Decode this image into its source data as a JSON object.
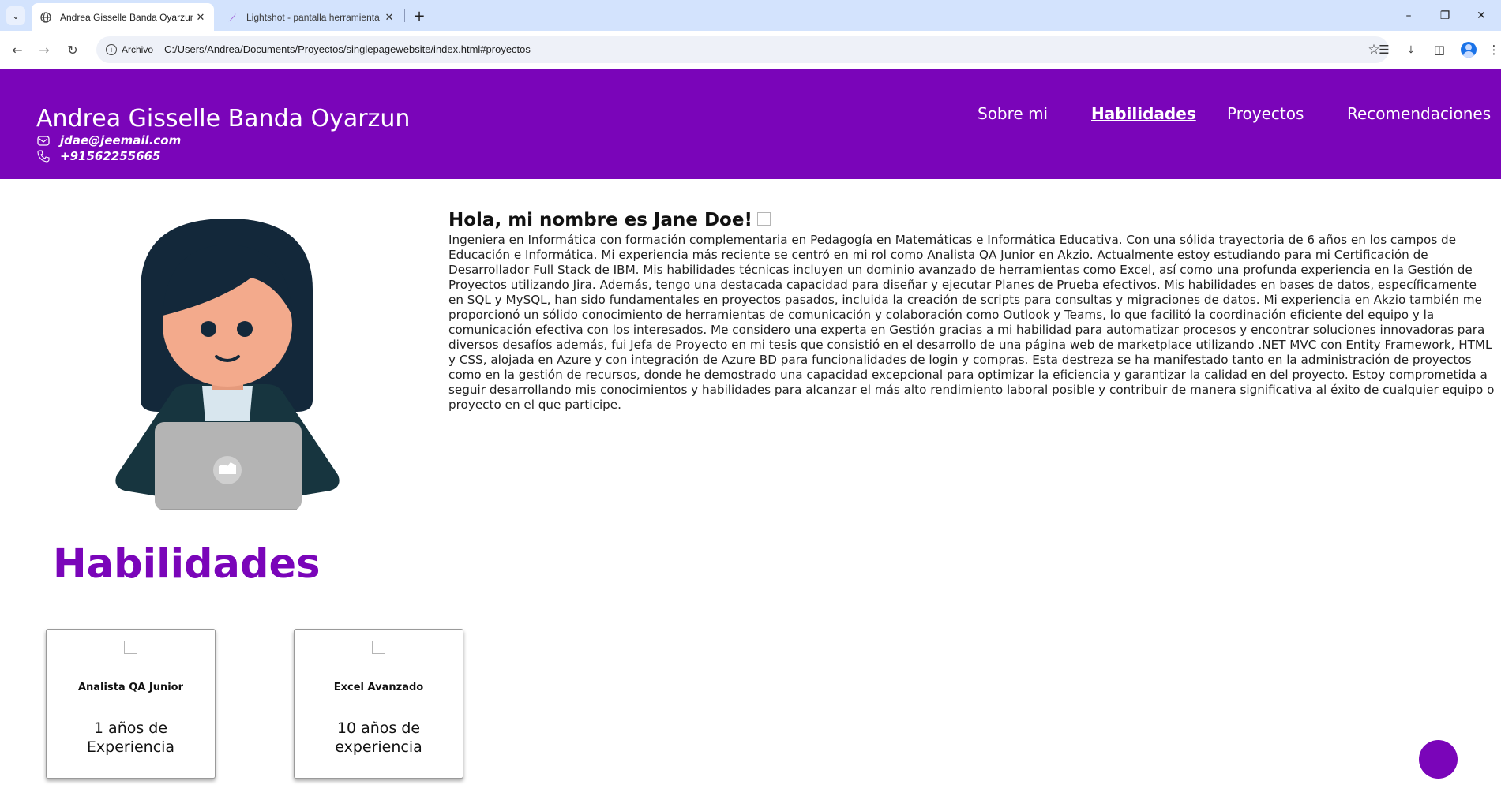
{
  "browser": {
    "tabs": [
      {
        "title": "Andrea Gisselle Banda Oyarzun",
        "favicon": "globe-icon",
        "active": true
      },
      {
        "title": "Lightshot - pantalla herramienta",
        "favicon": "feather-icon",
        "active": false
      }
    ],
    "chip_label": "Archivo",
    "url": "C:/Users/Andrea/Documents/Proyectos/singlepagewebsite/index.html#proyectos"
  },
  "header": {
    "name": "Andrea Gisselle Banda Oyarzun",
    "email": "jdae@jeemail.com",
    "phone": "+91562255665",
    "nav": [
      {
        "label": "Sobre mi",
        "active": false
      },
      {
        "label": "Habilidades",
        "active": true
      },
      {
        "label": "Proyectos",
        "active": false
      },
      {
        "label": "Recomendaciones",
        "active": false
      }
    ]
  },
  "intro": {
    "title": "Hola, mi nombre es Jane Doe!",
    "text": "Ingeniera en Informática con formación complementaria en Pedagogía en Matemáticas e Informática Educativa. Con una sólida trayectoria de 6 años en los campos de Educación e Informática. Mi experiencia más reciente se centró en mi rol como Analista QA Junior en Akzio. Actualmente estoy estudiando para mi Certificación de Desarrollador Full Stack de IBM. Mis habilidades técnicas incluyen un dominio avanzado de herramientas como Excel, así como una profunda experiencia en la Gestión de Proyectos utilizando Jira. Además, tengo una destacada capacidad para diseñar y ejecutar Planes de Prueba efectivos. Mis habilidades en bases de datos, específicamente en SQL y MySQL, han sido fundamentales en proyectos pasados, incluida la creación de scripts para consultas y migraciones de datos. Mi experiencia en Akzio también me proporcionó un sólido conocimiento de herramientas de comunicación y colaboración como Outlook y Teams, lo que facilitó la coordinación eficiente del equipo y la comunicación efectiva con los interesados. Me considero una experta en Gestión gracias a mi habilidad para automatizar procesos y encontrar soluciones innovadoras para diversos desafíos además, fui Jefa de Proyecto en mi tesis que consistió en el desarrollo de una página web de marketplace utilizando .NET MVC con Entity Framework, HTML y CSS, alojada en Azure y con integración de Azure BD para funcionalidades de login y compras. Esta destreza se ha manifestado tanto en la administración de proyectos como en la gestión de recursos, donde he demostrado una capacidad excepcional para optimizar la eficiencia y garantizar la calidad en del proyecto. Estoy comprometida a seguir desarrollando mis conocimientos y habilidades para alcanzar el más alto rendimiento laboral posible y contribuir de manera significativa al éxito de cualquier equipo o proyecto en el que participe."
  },
  "skills": {
    "title": "Habilidades",
    "cards": [
      {
        "name": "Analista QA Junior",
        "years": "1 años de Experiencia"
      },
      {
        "name": "Excel Avanzado",
        "years": "10 años de experiencia"
      }
    ]
  },
  "colors": {
    "brand_purple": "#7a05b9",
    "chrome_tabbar": "#d3e3fd",
    "avatar_hair": "#13283a",
    "avatar_skin": "#f3aa8c",
    "laptop": "#b4b4b4"
  }
}
